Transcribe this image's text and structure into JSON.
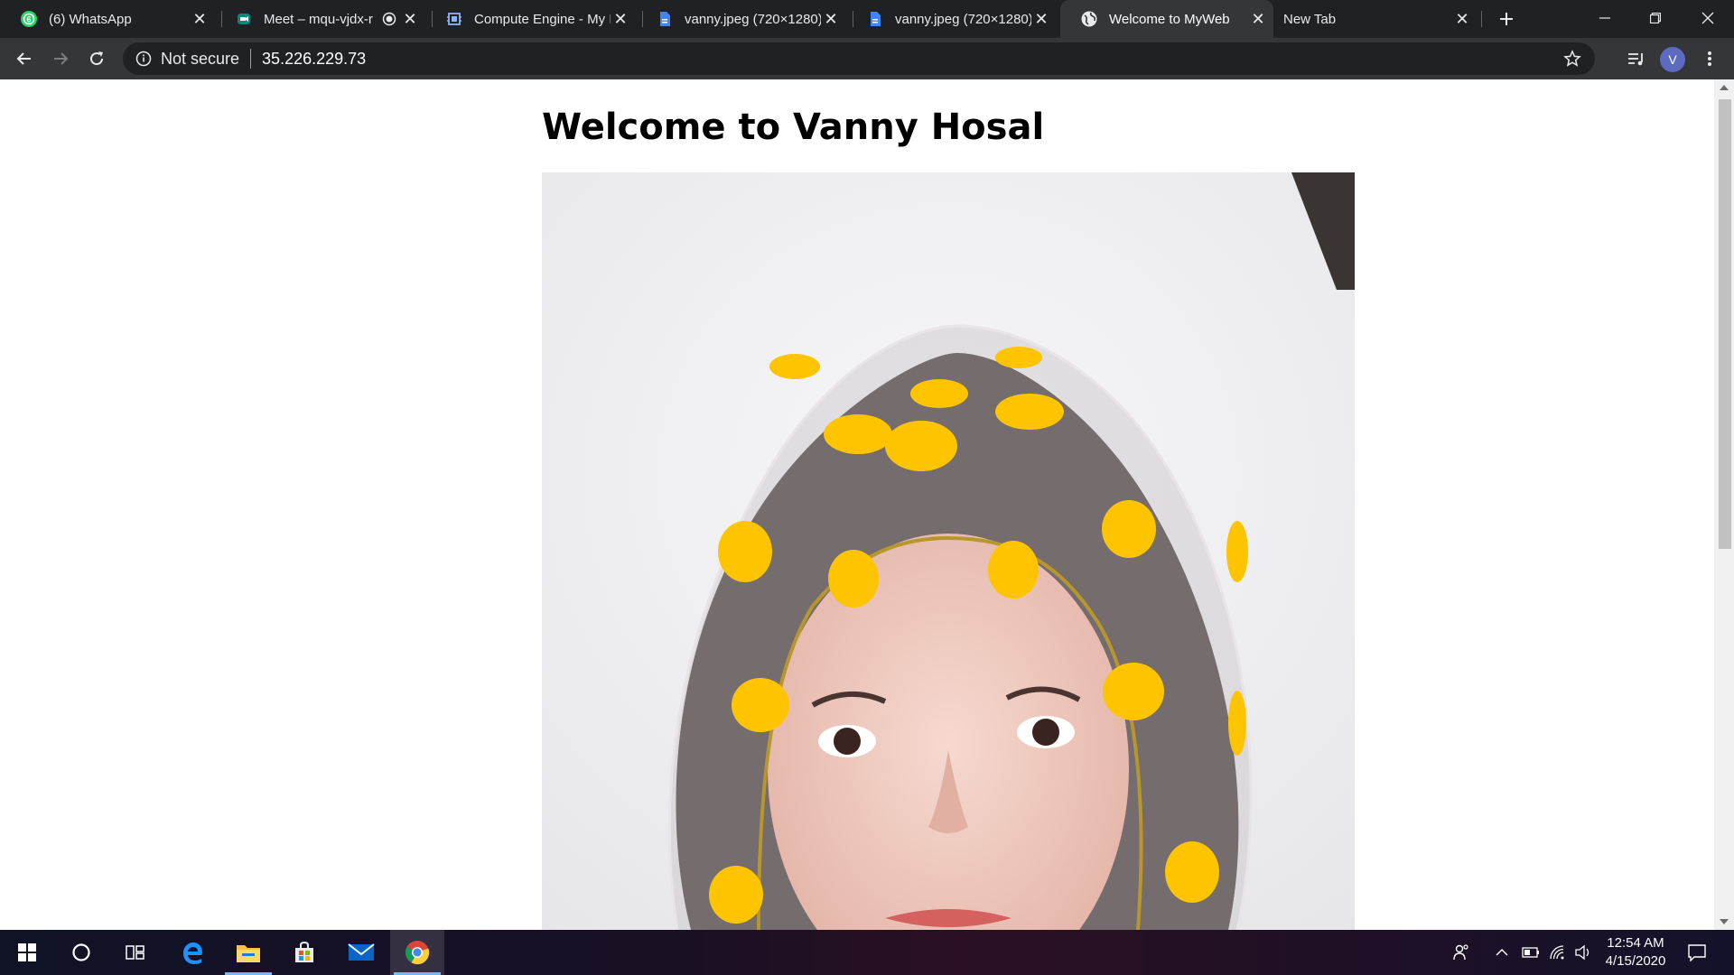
{
  "browser": {
    "tabs": [
      {
        "title": "(6) WhatsApp",
        "icon": "whatsapp-icon",
        "active": false
      },
      {
        "title": "Meet – mqu-vjdx-r",
        "icon": "meet-icon",
        "active": false
      },
      {
        "title": "Compute Engine - My I",
        "icon": "compute-engine-icon",
        "active": false
      },
      {
        "title": "vanny.jpeg (720×1280)",
        "icon": "image-file-icon",
        "active": false
      },
      {
        "title": "vanny.jpeg (720×1280)",
        "icon": "image-file-icon",
        "active": false
      },
      {
        "title": "Welcome to MyWeb",
        "icon": "globe-icon",
        "active": true
      },
      {
        "title": "New Tab",
        "icon": "",
        "active": false
      }
    ],
    "omnibox": {
      "security_label": "Not secure",
      "url": "35.226.229.73"
    },
    "profile_initial": "V"
  },
  "page": {
    "heading": "Welcome to Vanny Hosal",
    "photo_description_icon": "portrait-photo"
  },
  "taskbar": {
    "clock_time": "12:54 AM",
    "clock_date": "4/15/2020"
  },
  "colors": {
    "tab_strip": "#202124",
    "toolbar": "#35363a",
    "accent_whatsapp": "#25d366",
    "accent_meet": "#00897b",
    "accent_docs": "#4285f4",
    "avatar": "#5c6bc0"
  }
}
